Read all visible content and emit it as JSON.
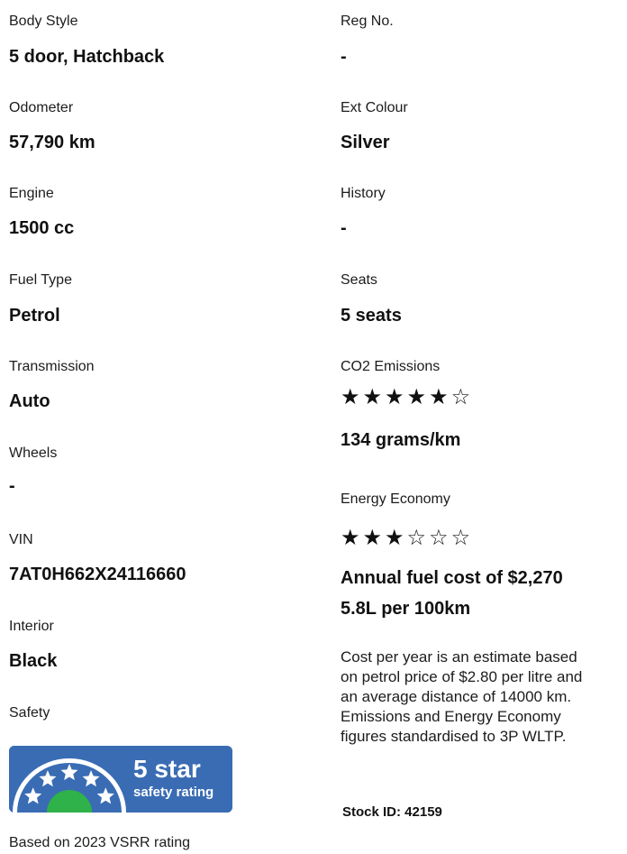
{
  "left": {
    "body_style": {
      "label": "Body Style",
      "value": "5 door, Hatchback"
    },
    "odometer": {
      "label": "Odometer",
      "value": "57,790 km"
    },
    "engine": {
      "label": "Engine",
      "value": "1500 cc"
    },
    "fuel_type": {
      "label": "Fuel Type",
      "value": "Petrol"
    },
    "transmission": {
      "label": "Transmission",
      "value": "Auto"
    },
    "wheels": {
      "label": "Wheels",
      "value": "-"
    },
    "vin": {
      "label": "VIN",
      "value": "7AT0H662X24116660"
    },
    "interior": {
      "label": "Interior",
      "value": "Black"
    },
    "safety": {
      "label": "Safety",
      "badge_main": "5 star",
      "badge_sub": "safety rating",
      "badge_stars": 5,
      "note": "Based on 2023 VSRR rating"
    }
  },
  "right": {
    "reg_no": {
      "label": "Reg No.",
      "value": "-"
    },
    "ext_colour": {
      "label": "Ext Colour",
      "value": "Silver"
    },
    "history": {
      "label": "History",
      "value": "-"
    },
    "seats": {
      "label": "Seats",
      "value": "5 seats"
    },
    "co2": {
      "label": "CO2 Emissions",
      "rating": 5,
      "max": 6,
      "value": "134 grams/km"
    },
    "energy": {
      "label": "Energy Economy",
      "rating": 3,
      "max": 6,
      "annual_cost": "Annual fuel cost of $2,270",
      "consumption": "5.8L per 100km"
    },
    "note_lines": [
      "Cost per year is an estimate based",
      "on petrol price of  $2.80 per litre and",
      "an average distance of 14000 km.",
      "Emissions and Energy Economy",
      "figures standardised to 3P WLTP."
    ],
    "stock_id": "Stock ID: 42159"
  },
  "colors": {
    "badge_bg": "#3a6cb4",
    "badge_green": "#2fb24a",
    "text": "#111111"
  },
  "icons": {
    "full_star": "★",
    "empty_star": "☆"
  }
}
